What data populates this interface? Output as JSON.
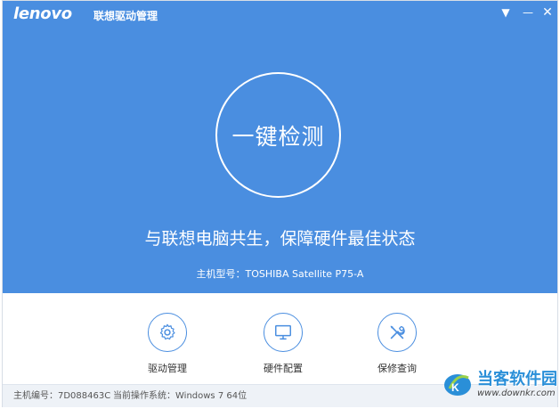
{
  "app": {
    "brand": "lenovo",
    "title": "联想驱动管理"
  },
  "window_controls": {
    "menu_icon": "triangle-down-icon",
    "minimize_icon": "minus-icon",
    "close_icon": "close-icon"
  },
  "hero": {
    "detect_button_label": "一键检测",
    "slogan": "与联想电脑共生，保障硬件最佳状态",
    "model_prefix": "主机型号：",
    "model_value": "TOSHIBA Satellite P75-A"
  },
  "tools": [
    {
      "label": "驱动管理",
      "icon": "gear-icon"
    },
    {
      "label": "硬件配置",
      "icon": "monitor-icon"
    },
    {
      "label": "保修查询",
      "icon": "tools-icon"
    }
  ],
  "status": {
    "id_label": "主机编号：7D088463C",
    "os_label": "当前操作系统：Windows 7 64位"
  },
  "watermark": {
    "title": "当客软件园",
    "url": "www.downkr.com"
  },
  "colors": {
    "primary": "#4a8ee0",
    "status_bg": "#eef2f7"
  }
}
